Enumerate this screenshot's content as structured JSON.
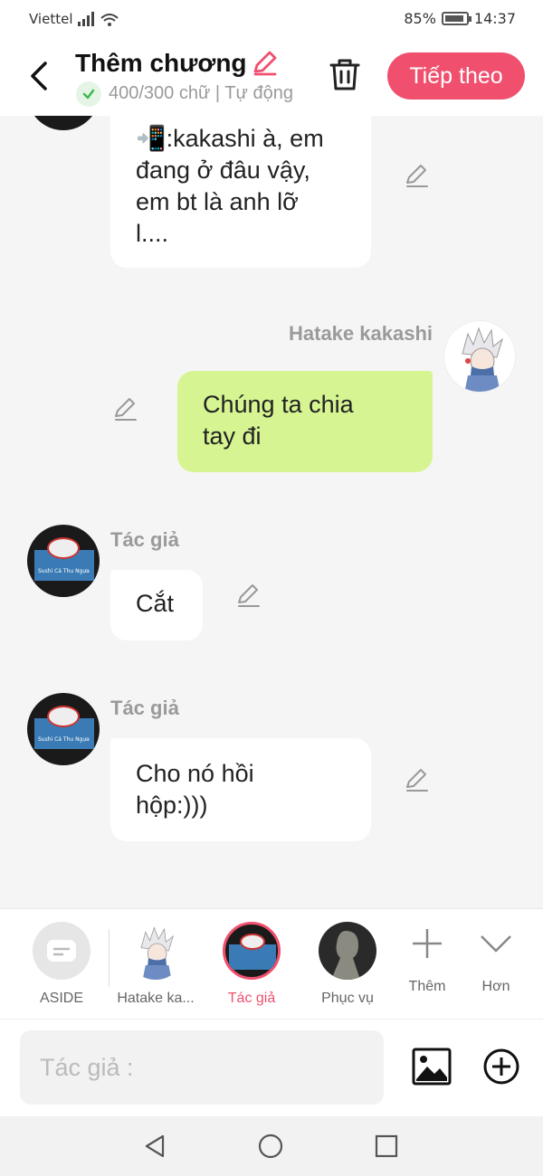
{
  "status": {
    "carrier": "Viettel",
    "battery": "85%",
    "time": "14:37"
  },
  "header": {
    "title": "Thêm chương",
    "meta": "400/300 chữ | Tự động",
    "next_label": "Tiếp theo"
  },
  "messages": [
    {
      "sender": "",
      "text": "📲:kakashi à, em đang ở đâu vậy, em bt là anh lỡ l....",
      "lines": [
        "📲:kakashi à, em",
        "đang ở đâu vậy,",
        "em bt là anh lỡ",
        "l...."
      ],
      "side": "left"
    },
    {
      "sender": "Hatake kakashi",
      "text": "Chúng ta chia tay đi",
      "lines": [
        "Chúng ta chia",
        "tay đi"
      ],
      "side": "right"
    },
    {
      "sender": "Tác giả",
      "text": "Cắt",
      "lines": [
        "Cắt"
      ],
      "side": "left"
    },
    {
      "sender": "Tác giả",
      "text": "Cho nó hồi hộp:)))",
      "lines": [
        "Cho nó hồi",
        "hộp:)))"
      ],
      "side": "left"
    }
  ],
  "characters": [
    {
      "label": "ASIDE"
    },
    {
      "label": "Hatake ka..."
    },
    {
      "label": "Tác giả",
      "selected": true
    },
    {
      "label": "Phục vụ"
    },
    {
      "label": "Thêm"
    },
    {
      "label": "Hơn"
    }
  ],
  "composer": {
    "placeholder": "Tác giả :"
  },
  "colors": {
    "accent": "#f0506e",
    "green_bubble": "#d6f592",
    "check": "#3fb950"
  },
  "icons": [
    "back-arrow-icon",
    "pencil-icon",
    "check-icon",
    "trash-icon",
    "plus-icon",
    "chevron-down-icon",
    "image-icon",
    "add-circle-icon",
    "nav-back-icon",
    "nav-home-icon",
    "nav-recent-icon"
  ]
}
